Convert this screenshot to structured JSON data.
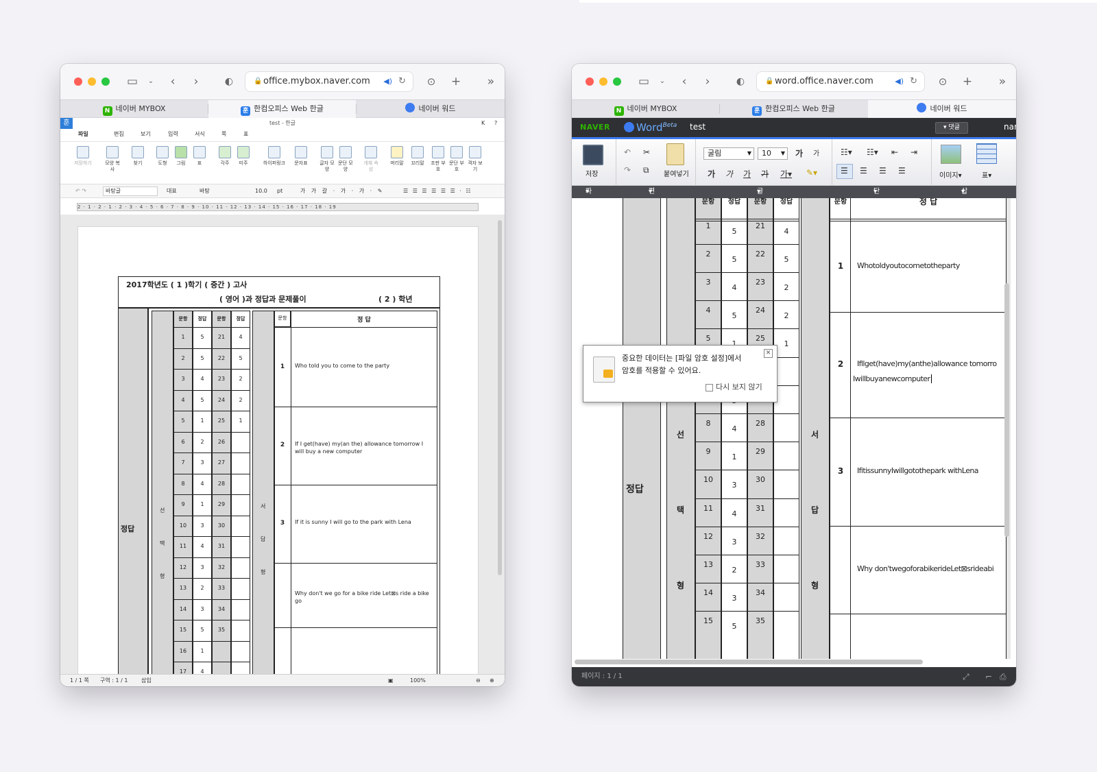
{
  "left_window": {
    "url": "office.mybox.naver.com",
    "tabs": [
      "네이버 MYBOX",
      "한컴오피스 Web 한글",
      "네이버 워드"
    ],
    "app_badge": "훈",
    "doc_title": "test - 한글",
    "menu": [
      "파일",
      "편집",
      "보기",
      "입력",
      "서식",
      "쪽",
      "표"
    ],
    "menu_right": [
      "K",
      "?"
    ],
    "ribbon": [
      "저장하기",
      "모양 복사",
      "찾기",
      "도형",
      "그림",
      "표",
      "각주",
      "미주",
      "하이퍼링크",
      "문자표",
      "글자 모양",
      "문단 모양",
      "개체 속성",
      "머리말",
      "꼬리말",
      "조판 부호",
      "문단 부호",
      "격자 보기"
    ],
    "format": {
      "style": "바탕글",
      "lang": "대표",
      "font": "바탕",
      "size": "10.0",
      "unit": "pt"
    },
    "ruler": "2 · 1 · 2 · 1 · 2 · 3 · 4 · 5 · 6 · 7 · 8 · 9 · 10 · 11 · 12 · 13 · 14 · 15 · 16 · 17 · 18 · 19",
    "status": {
      "page": "1 / 1 쪽",
      "section": "구역 : 1 / 1",
      "mode": "삽입",
      "zoom": "100%"
    }
  },
  "right_window": {
    "url": "word.office.naver.com",
    "tabs": [
      "네이버 MYBOX",
      "한컴오피스 Web 한글",
      "네이버 워드"
    ],
    "brand": "NAVER",
    "product": "Word",
    "beta": "Beta",
    "filename": "test",
    "comment_btn": "댓글",
    "user_name": "nar",
    "ribbon": {
      "save": "저장",
      "paste": "붙여넣기",
      "font": "굴림",
      "size": "10",
      "image": "이미지",
      "table": "표"
    },
    "groups": [
      "파일",
      "편집",
      "글꼴",
      "단락",
      "삽입"
    ],
    "popup": {
      "line1": "중요한 데이터는 [파일 암호 설정]에서",
      "line2": "암호를 적용할 수 있어요.",
      "check": "다시 보지 않기"
    },
    "status": "페이지 : 1 / 1"
  },
  "exam": {
    "title": "2017학년도  ( 1 )학기  ( 중간 ) 고사",
    "subtitle_subject": "(  영어  )과  정답과 문제풀이",
    "subtitle_grade": "( 2 ) 학년",
    "section_label": "정답",
    "choice_label": [
      "선",
      "택",
      "형"
    ],
    "essay_label": [
      "서",
      "답",
      "형"
    ],
    "col_q": "문항",
    "col_a": "정답",
    "col_answer_header": "정   답",
    "rows": [
      {
        "q1": "1",
        "a1": "5",
        "q2": "21",
        "a2": "4"
      },
      {
        "q1": "2",
        "a1": "5",
        "q2": "22",
        "a2": "5"
      },
      {
        "q1": "3",
        "a1": "4",
        "q2": "23",
        "a2": "2"
      },
      {
        "q1": "4",
        "a1": "5",
        "q2": "24",
        "a2": "2"
      },
      {
        "q1": "5",
        "a1": "1",
        "q2": "25",
        "a2": "1"
      },
      {
        "q1": "6",
        "a1": "2",
        "q2": "26",
        "a2": ""
      },
      {
        "q1": "7",
        "a1": "3",
        "q2": "27",
        "a2": ""
      },
      {
        "q1": "8",
        "a1": "4",
        "q2": "28",
        "a2": ""
      },
      {
        "q1": "9",
        "a1": "1",
        "q2": "29",
        "a2": ""
      },
      {
        "q1": "10",
        "a1": "3",
        "q2": "30",
        "a2": ""
      },
      {
        "q1": "11",
        "a1": "4",
        "q2": "31",
        "a2": ""
      },
      {
        "q1": "12",
        "a1": "3",
        "q2": "32",
        "a2": ""
      },
      {
        "q1": "13",
        "a1": "2",
        "q2": "33",
        "a2": ""
      },
      {
        "q1": "14",
        "a1": "3",
        "q2": "34",
        "a2": ""
      },
      {
        "q1": "15",
        "a1": "5",
        "q2": "35",
        "a2": ""
      },
      {
        "q1": "16",
        "a1": "1",
        "q2": "",
        "a2": ""
      },
      {
        "q1": "17",
        "a1": "4",
        "q2": "",
        "a2": ""
      }
    ],
    "essays_left": [
      {
        "n": "1",
        "text": "Who told you to come to the party"
      },
      {
        "n": "2",
        "text": "If I get(have) my(an the) allowance tomorrow I will buy a new computer"
      },
      {
        "n": "3",
        "text": "If it is sunny I will go to the park with Lena"
      },
      {
        "n": "",
        "text": "Why don't we go for a bike ride  Let⊠s ride a bike    go"
      }
    ],
    "essays_right": [
      {
        "n": "1",
        "text": "Whotoldyoutocometotheparty"
      },
      {
        "n": "2",
        "text": "Ifllget(have)my(anthe)allowance tomorro",
        "text2": "Iwillbuyanewcomputer"
      },
      {
        "n": "3",
        "text": "IfitissunnyIwillgotothepark withLena"
      },
      {
        "n": "",
        "text": "Why don'twegoforabikerideLet⊠srideabi"
      }
    ]
  }
}
